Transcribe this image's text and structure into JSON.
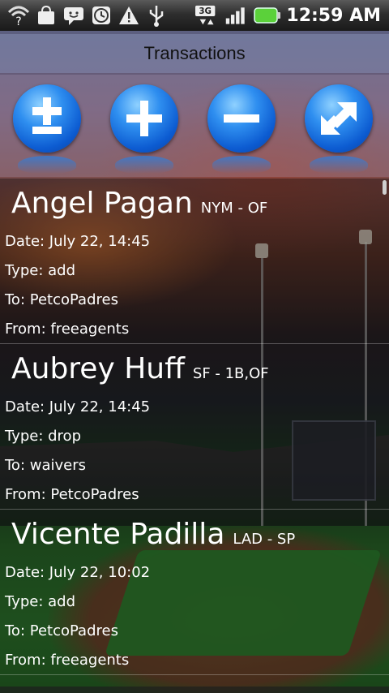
{
  "status_bar": {
    "time": "12:59 AM",
    "icons": [
      "wifi-question-icon",
      "bag-icon",
      "messaging-icon",
      "clock-icon",
      "warning-icon",
      "usb-icon",
      "3g-icon",
      "signal-icon",
      "battery-icon"
    ],
    "network_label": "3G"
  },
  "title": "Transactions",
  "toolbar": {
    "buttons": [
      {
        "name": "plus-minus-button",
        "icon": "plus-minus-icon"
      },
      {
        "name": "add-button",
        "icon": "plus-icon"
      },
      {
        "name": "drop-button",
        "icon": "minus-icon"
      },
      {
        "name": "trade-button",
        "icon": "swap-arrows-icon"
      }
    ]
  },
  "transactions": [
    {
      "player": "Angel Pagan",
      "meta": "NYM - OF",
      "date": "Date: July 22, 14:45",
      "type": "Type: add",
      "to": "To: PetcoPadres",
      "from": "From: freeagents"
    },
    {
      "player": "Aubrey Huff",
      "meta": "SF - 1B,OF",
      "date": "Date: July 22, 14:45",
      "type": "Type: drop",
      "to": "To: waivers",
      "from": "From: PetcoPadres"
    },
    {
      "player": "Vicente Padilla",
      "meta": "LAD - SP",
      "date": "Date: July 22, 10:02",
      "type": "Type: add",
      "to": "To: PetcoPadres",
      "from": "From: freeagents"
    }
  ],
  "colors": {
    "button_blue": "#1f74e0",
    "battery_green": "#5bd13a"
  }
}
